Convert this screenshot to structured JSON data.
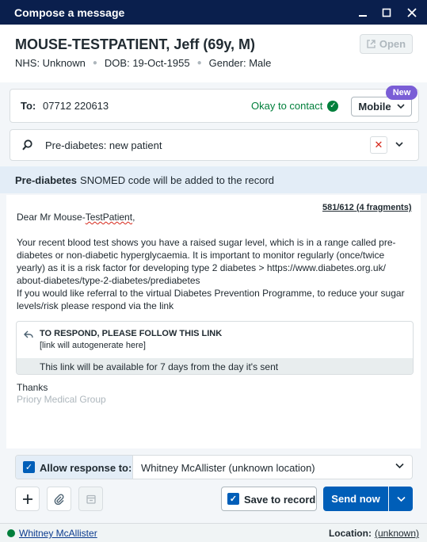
{
  "window": {
    "title": "Compose a message"
  },
  "patient": {
    "name": "MOUSE-TESTPATIENT, Jeff (69y, M)",
    "nhs": "NHS: Unknown",
    "dob": "DOB: 19-Oct-1955",
    "gender": "Gender: Male",
    "open_label": "Open"
  },
  "recipient": {
    "to_label": "To:",
    "number": "07712 220613",
    "contact_status": "Okay to contact",
    "type": "Mobile",
    "badge": "New"
  },
  "template": {
    "name": "Pre-diabetes: new patient"
  },
  "snomed": {
    "bold": "Pre-diabetes",
    "text": "SNOMED code will be added to the record"
  },
  "message": {
    "fragments": "581/612 (4 fragments)",
    "greeting_prefix": "Dear Mr Mouse-",
    "greeting_name": "TestPatient",
    "greeting_suffix": ",",
    "body1": "Your recent blood test shows you have a raised sugar level, which is in a range called pre-diabetes or non-diabetic hyperglycaemia. It is important to monitor regularly (once/twice yearly) as it is a risk factor for developing type 2 diabetes > https://www.diabetes.org.uk/ about-diabetes/type-2-diabetes/prediabetes",
    "body2": "If you would like referral to the virtual Diabetes Prevention Programme, to reduce your sugar levels/risk please respond via the link",
    "link_heading": "TO RESPOND, PLEASE FOLLOW THIS LINK",
    "link_placeholder": "[link will autogenerate here]",
    "link_availability": "This link will be available for 7 days from the day it's sent",
    "signoff": "Thanks",
    "org": "Priory Medical Group"
  },
  "response": {
    "label": "Allow response to:",
    "value": "Whitney McAllister (unknown location)"
  },
  "actions": {
    "save_label": "Save to record",
    "send_label": "Send now"
  },
  "status": {
    "user": "Whitney McAllister",
    "location_label": "Location:",
    "location_value": "(unknown)"
  },
  "colors": {
    "titlebar": "#0a1f4d",
    "primary": "#005eb8",
    "success": "#007f3b",
    "badge": "#7a5ed6",
    "danger": "#d5281b"
  }
}
